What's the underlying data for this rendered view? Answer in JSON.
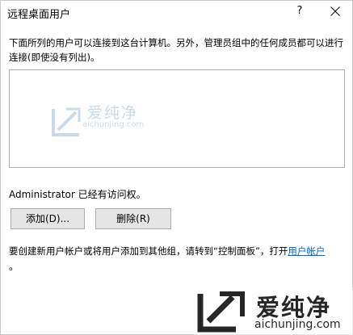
{
  "window": {
    "title": "远程桌面用户",
    "help_label": "?"
  },
  "description": "下面所列的用户可以连接到这台计算机。另外，管理员组中的任何成员都可以进行连接(即使没有列出)。",
  "user_list": {
    "items": []
  },
  "access_status": "Administrator 已经有访问权。",
  "buttons": {
    "add_label": "添加(D)...",
    "remove_label": "删除(R)"
  },
  "footer": {
    "text": "要创建新用户帐户或将用户添加到其他组，请转到“控制面板”，打开",
    "link": "用户帐户",
    "period": "。"
  },
  "watermark": {
    "title": "爱纯净",
    "url": "aichunjing.com"
  },
  "colors": {
    "link": "#0066cc",
    "button_bg": "#e5e5e5",
    "border": "#adadad"
  }
}
